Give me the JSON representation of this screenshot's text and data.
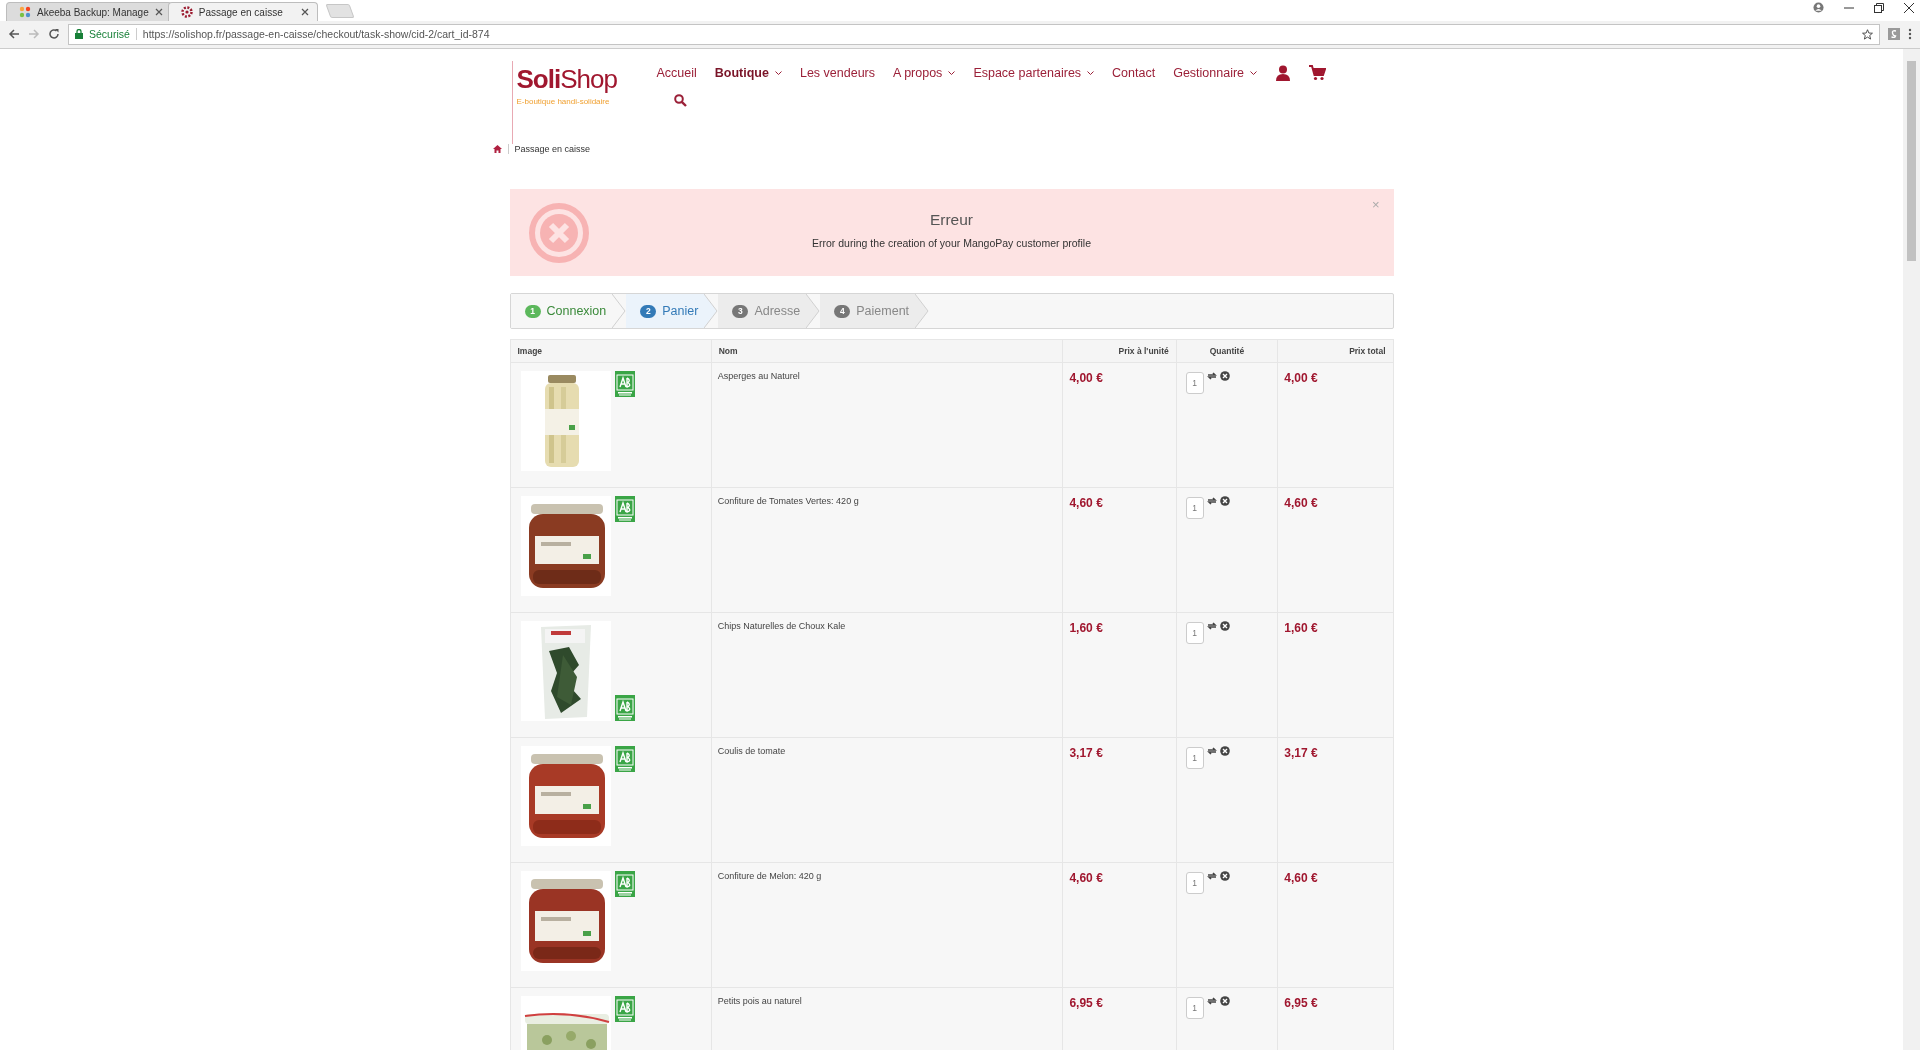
{
  "browser": {
    "tabs": [
      {
        "title": "Akeeba Backup: Manage",
        "selected": false
      },
      {
        "title": "Passage en caisse",
        "selected": true
      }
    ],
    "security_label": "Sécurisé",
    "url": "https://solishop.fr/passage-en-caisse/checkout/task-show/cid-2/cart_id-874"
  },
  "header": {
    "logo": {
      "name": "**Soli**Shop",
      "tagline": "E-boutique handi-solidaire"
    },
    "nav": [
      {
        "label": "Accueil",
        "selected": false,
        "dropdown": false
      },
      {
        "label": "Boutique",
        "selected": true,
        "dropdown": true
      },
      {
        "label": "Les vendeurs",
        "selected": false,
        "dropdown": false
      },
      {
        "label": "A propos",
        "selected": false,
        "dropdown": true
      },
      {
        "label": "Espace partenaires",
        "selected": false,
        "dropdown": true
      },
      {
        "label": "Contact",
        "selected": false,
        "dropdown": false
      },
      {
        "label": "Gestionnaire",
        "selected": false,
        "dropdown": true
      }
    ]
  },
  "breadcrumb": [
    "Passage en caisse"
  ],
  "alert": {
    "title": "Erreur",
    "message": "Error during the creation of your MangoPay customer profile",
    "close": "×"
  },
  "steps": [
    {
      "number": "1",
      "label": "Connexion",
      "completed": true,
      "selected": false
    },
    {
      "number": "2",
      "label": "Panier",
      "completed": false,
      "selected": true
    },
    {
      "number": "3",
      "label": "Adresse",
      "completed": false,
      "selected": false
    },
    {
      "number": "4",
      "label": "Paiement",
      "completed": false,
      "selected": false
    }
  ],
  "table": {
    "columns": [
      "Image",
      "Nom",
      "Prix à l'unité",
      "Quantité",
      "Prix total"
    ],
    "rows": [
      {
        "name": "Asperges au Naturel",
        "unit_price": "4,00 €",
        "quantity": "1",
        "total": "4,00 €"
      },
      {
        "name": "Confiture de Tomates Vertes: 420 g",
        "unit_price": "4,60 €",
        "quantity": "1",
        "total": "4,60 €"
      },
      {
        "name": "Chips Naturelles de Choux Kale",
        "unit_price": "1,60 €",
        "quantity": "1",
        "total": "1,60 €"
      },
      {
        "name": "Coulis de tomate",
        "unit_price": "3,17 €",
        "quantity": "1",
        "total": "3,17 €"
      },
      {
        "name": "Confiture de Melon: 420 g",
        "unit_price": "4,60 €",
        "quantity": "1",
        "total": "4,60 €"
      },
      {
        "name": "Petits pois au naturel",
        "unit_price": "6,95 €",
        "quantity": "1",
        "total": "6,95 €"
      }
    ]
  }
}
